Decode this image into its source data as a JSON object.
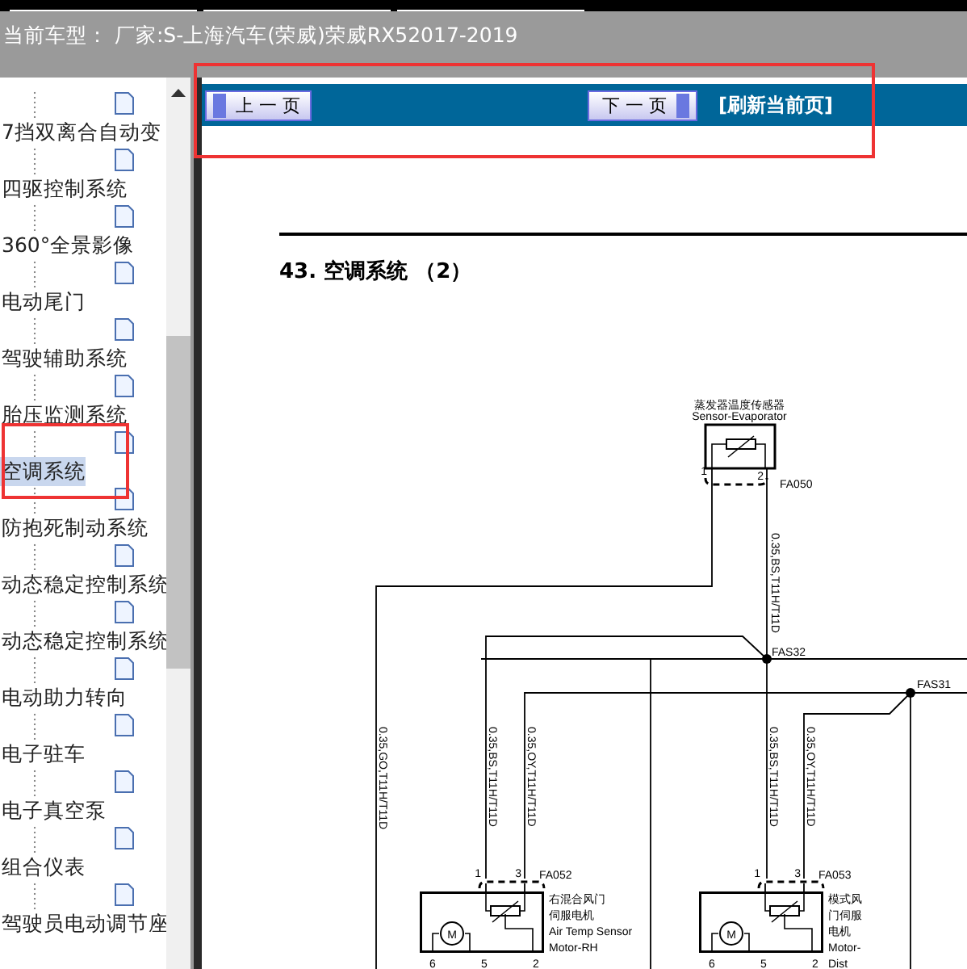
{
  "header": {
    "title": "当前车型： 厂家:S-上海汽车(荣威)荣威RX52017-2019"
  },
  "tree": {
    "items": [
      {
        "label": "7挡双离合自动变",
        "selected": false
      },
      {
        "label": "四驱控制系统",
        "selected": false
      },
      {
        "label": "360°全景影像",
        "selected": false
      },
      {
        "label": "电动尾门",
        "selected": false
      },
      {
        "label": "驾驶辅助系统",
        "selected": false
      },
      {
        "label": "胎压监测系统",
        "selected": false
      },
      {
        "label": "空调系统",
        "selected": true
      },
      {
        "label": "防抱死制动系统",
        "selected": false
      },
      {
        "label": "动态稳定控制系统",
        "selected": false
      },
      {
        "label": "动态稳定控制系统",
        "selected": false
      },
      {
        "label": "电动助力转向",
        "selected": false
      },
      {
        "label": "电子驻车",
        "selected": false
      },
      {
        "label": "电子真空泵",
        "selected": false
      },
      {
        "label": "组合仪表",
        "selected": false
      },
      {
        "label": "驾驶员电动调节座",
        "selected": false
      }
    ]
  },
  "toolbar": {
    "prev": "上 一 页",
    "next": "下 一 页",
    "refresh": "[刷新当前页]"
  },
  "document": {
    "title": "43.  空调系统 （2）",
    "sensor": {
      "name_cn": "蒸发器温度传感器",
      "name_en": "Sensor-Evaporator",
      "connector": "FA050",
      "pins": [
        "1",
        "2"
      ],
      "wire": "0.35,BS,T11H/T11D"
    },
    "splices": [
      "FAS32",
      "FAS31"
    ],
    "wires": [
      "0.35,GO,T11H/T11D",
      "0.35,BS,T11H/T11D",
      "0.35,OY,T11H/T11D",
      "0.35,BS,T11H/T11D",
      "0.35,OY,T11H/T11D"
    ],
    "motors": [
      {
        "connector": "FA052",
        "lines": [
          "右混合风门",
          "伺服电机",
          "Air Temp Sensor",
          "Motor-RH"
        ],
        "top_pins": [
          "1",
          "3"
        ],
        "bottom_pins": [
          "6",
          "5",
          "2"
        ],
        "motor": "M"
      },
      {
        "connector": "FA053",
        "lines": [
          "模式风",
          "门伺服",
          "电机",
          "Motor-",
          "Dist"
        ],
        "top_pins": [
          "1",
          "3"
        ],
        "bottom_pins": [
          "6",
          "5",
          "2"
        ],
        "motor": "M"
      }
    ]
  }
}
